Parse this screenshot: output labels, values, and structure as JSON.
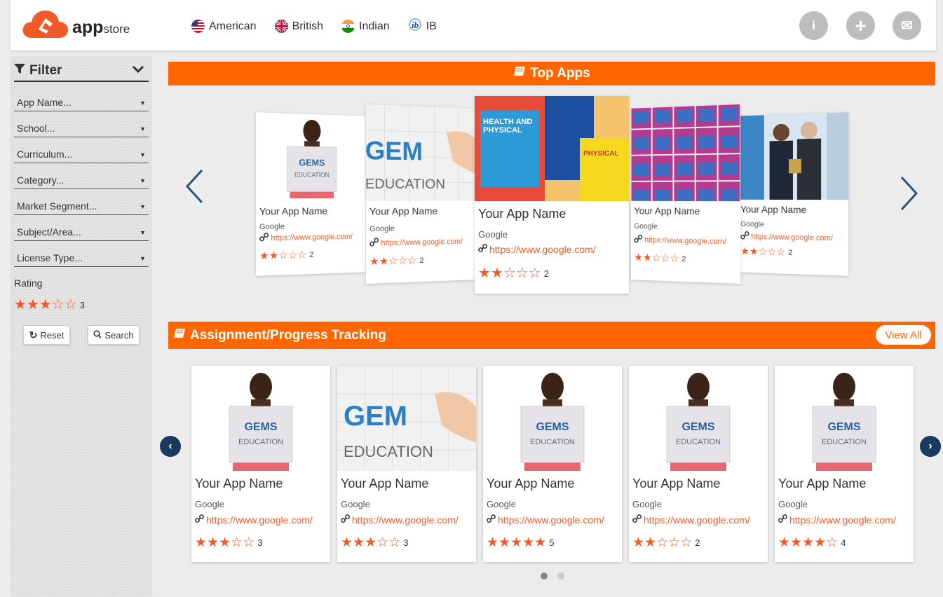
{
  "header": {
    "logo_main": "app",
    "logo_sub": "store",
    "nav": [
      {
        "label": "American",
        "icon": "us-flag-icon"
      },
      {
        "label": "British",
        "icon": "uk-flag-icon"
      },
      {
        "label": "Indian",
        "icon": "india-flag-icon"
      },
      {
        "label": "IB",
        "icon": "ib-logo-icon"
      }
    ],
    "buttons": [
      {
        "icon": "info-icon",
        "glyph": "i"
      },
      {
        "icon": "plus-icon",
        "glyph": "+"
      },
      {
        "icon": "mail-icon",
        "glyph": "✉"
      }
    ]
  },
  "sidebar": {
    "title": "Filter",
    "selects": [
      "App Name...",
      "School...",
      "Curriculum...",
      "Category...",
      "Market Segment...",
      "Subject/Area...",
      "License Type..."
    ],
    "rating_label": "Rating",
    "rating_value": 3,
    "rating_text": "3",
    "reset_label": "Reset",
    "search_label": "Search"
  },
  "top_apps": {
    "title": "Top Apps",
    "cards": [
      {
        "name": "Your App Name",
        "developer": "Google",
        "url": "https://www.google.com/",
        "rating": 2,
        "rating_text": "2",
        "image": "student"
      },
      {
        "name": "Your App Name",
        "developer": "Google",
        "url": "https://www.google.com/",
        "rating": 2,
        "rating_text": "2",
        "image": "puzzle"
      },
      {
        "name": "Your App Name",
        "developer": "Google",
        "url": "https://www.google.com/",
        "rating": 2,
        "rating_text": "2",
        "image": "pe-books"
      },
      {
        "name": "Your App Name",
        "developer": "Google",
        "url": "https://www.google.com/",
        "rating": 2,
        "rating_text": "2",
        "image": "it-books"
      },
      {
        "name": "Your App Name",
        "developer": "Google",
        "url": "https://www.google.com/",
        "rating": 2,
        "rating_text": "2",
        "image": "award"
      }
    ]
  },
  "assignment": {
    "title": "Assignment/Progress Tracking",
    "view_all": "View All",
    "cards": [
      {
        "name": "Your App Name",
        "developer": "Google",
        "url": "https://www.google.com/",
        "rating": 3,
        "rating_text": "3",
        "image": "student"
      },
      {
        "name": "Your App Name",
        "developer": "Google",
        "url": "https://www.google.com/",
        "rating": 3,
        "rating_text": "3",
        "image": "puzzle"
      },
      {
        "name": "Your App Name",
        "developer": "Google",
        "url": "https://www.google.com/",
        "rating": 5,
        "rating_text": "5",
        "image": "student"
      },
      {
        "name": "Your App Name",
        "developer": "Google",
        "url": "https://www.google.com/",
        "rating": 2,
        "rating_text": "2",
        "image": "student"
      },
      {
        "name": "Your App Name",
        "developer": "Google",
        "url": "https://www.google.com/",
        "rating": 4,
        "rating_text": "4",
        "image": "student"
      }
    ],
    "pages": 2,
    "active_page": 1
  },
  "colors": {
    "accent": "#ff6600",
    "star": "#f05a28",
    "nav_arrow": "#2b5377"
  }
}
